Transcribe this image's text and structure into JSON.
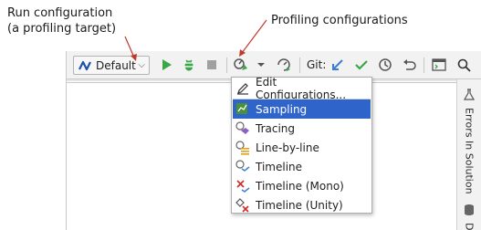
{
  "callouts": {
    "run_line1": "Run configuration",
    "run_line2": "(a profiling target)",
    "profiling": "Profiling configurations"
  },
  "toolbar": {
    "run_config_label": "Default",
    "git_label": "Git:",
    "icons": [
      "dotnet-icon",
      "run-icon",
      "debug-icon",
      "stop-icon",
      "profile-icon",
      "dropdown-caret-icon",
      "attach-profiler-icon",
      "git-update-icon",
      "git-commit-icon",
      "git-history-icon",
      "git-rollback-icon",
      "terminal-icon",
      "search-icon"
    ]
  },
  "menu": {
    "items": [
      {
        "label": "Edit Configurations...",
        "icon": "pencil-icon"
      },
      {
        "label": "Sampling",
        "icon": "sampling-icon",
        "selected": true
      },
      {
        "label": "Tracing",
        "icon": "tracing-icon"
      },
      {
        "label": "Line-by-line",
        "icon": "line-by-line-icon"
      },
      {
        "label": "Timeline",
        "icon": "timeline-icon"
      },
      {
        "label": "Timeline (Mono)",
        "icon": "timeline-mono-icon"
      },
      {
        "label": "Timeline (Unity)",
        "icon": "timeline-unity-icon"
      }
    ]
  },
  "right_panel": {
    "errors_tab": "Errors In Solution",
    "db_tab": "D"
  },
  "colors": {
    "selection": "#2f65ca",
    "run_green": "#3aa648",
    "stop_gray": "#a0a0a0",
    "git_blue": "#3d7dd1",
    "arrow_red": "#c0392b"
  }
}
